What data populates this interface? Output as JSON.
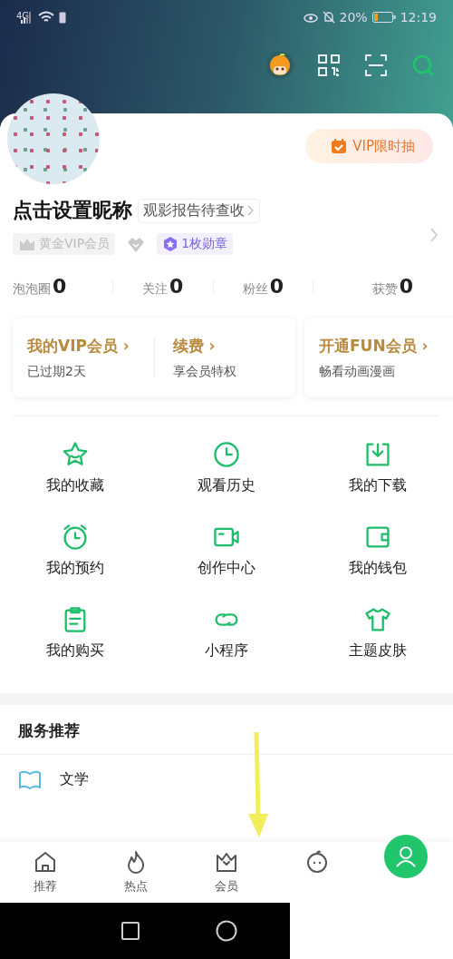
{
  "status_bar": {
    "network": "4G",
    "battery": "20%",
    "time": "12:19"
  },
  "profile": {
    "nickname": "点击设置昵称",
    "report_link": "观影报告待查收",
    "vip_button": "VIP限时抽",
    "badges": [
      {
        "kind": "vip",
        "label": "黄金VIP会员"
      },
      {
        "kind": "level"
      },
      {
        "kind": "medal",
        "label": "1枚勋章"
      }
    ]
  },
  "stats": [
    {
      "label": "泡泡圈",
      "value": "0"
    },
    {
      "label": "关注",
      "value": "0"
    },
    {
      "label": "粉丝",
      "value": "0"
    },
    {
      "label": "获赞",
      "value": "0"
    }
  ],
  "vip_cards": [
    {
      "items": [
        {
          "title": "我的VIP会员 ›",
          "subtitle": "已过期2天"
        },
        {
          "title": "续费 ›",
          "subtitle": "享会员特权"
        }
      ]
    },
    {
      "items": [
        {
          "title": "开通FUN会员 ›",
          "subtitle": "畅看动画漫画"
        }
      ]
    }
  ],
  "features": [
    {
      "kind": "star",
      "label": "我的收藏"
    },
    {
      "kind": "clock",
      "label": "观看历史"
    },
    {
      "kind": "download",
      "label": "我的下载"
    },
    {
      "kind": "alarm",
      "label": "我的预约"
    },
    {
      "kind": "video",
      "label": "创作中心"
    },
    {
      "kind": "wallet",
      "label": "我的钱包"
    },
    {
      "kind": "clipboard",
      "label": "我的购买"
    },
    {
      "kind": "link",
      "label": "小程序"
    },
    {
      "kind": "shirt",
      "label": "主题皮肤"
    }
  ],
  "services": {
    "title": "服务推荐",
    "items": [
      {
        "label": "文学"
      }
    ]
  },
  "bottom_nav": [
    {
      "kind": "home",
      "label": "推荐",
      "selected": false
    },
    {
      "kind": "fire",
      "label": "热点",
      "selected": false
    },
    {
      "kind": "crown",
      "label": "会员",
      "selected": false
    },
    {
      "kind": "face",
      "selected": false
    },
    {
      "kind": "profile",
      "selected": true
    }
  ]
}
